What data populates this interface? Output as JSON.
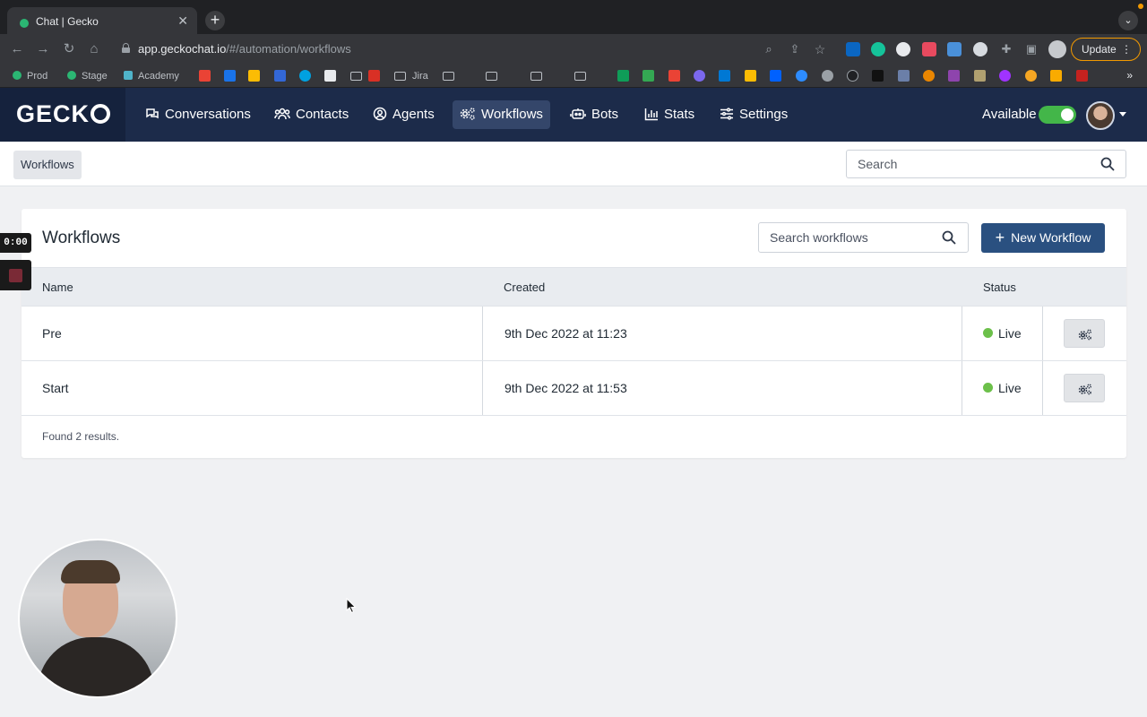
{
  "browser": {
    "tab_title": "Chat | Gecko",
    "url_host": "app.geckochat.io",
    "url_path": "/#/automation/workflows",
    "update_label": "Update",
    "bookmarks": [
      "Prod",
      "Stage",
      "Academy",
      "Jira"
    ]
  },
  "app": {
    "logo": "GECK",
    "nav": [
      "Conversations",
      "Contacts",
      "Agents",
      "Workflows",
      "Bots",
      "Stats",
      "Settings"
    ],
    "active_nav": "Workflows",
    "availability_label": "Available",
    "available": true
  },
  "subheader": {
    "breadcrumb": "Workflows",
    "search_placeholder": "Search"
  },
  "workflows": {
    "title": "Workflows",
    "search_placeholder": "Search workflows",
    "new_button": "New Workflow",
    "columns": {
      "name": "Name",
      "created": "Created",
      "status": "Status"
    },
    "rows": [
      {
        "name": "Pre",
        "created": "9th Dec 2022 at 11:23",
        "status": "Live"
      },
      {
        "name": "Start",
        "created": "9th Dec 2022 at 11:53",
        "status": "Live"
      }
    ],
    "footer": "Found 2 results."
  },
  "recording": {
    "timer": "0:00"
  },
  "colors": {
    "nav_bg": "#1c2b4a",
    "primary_button": "#2a5080",
    "live_status": "#6cc04a",
    "toggle_on": "#43b649"
  }
}
